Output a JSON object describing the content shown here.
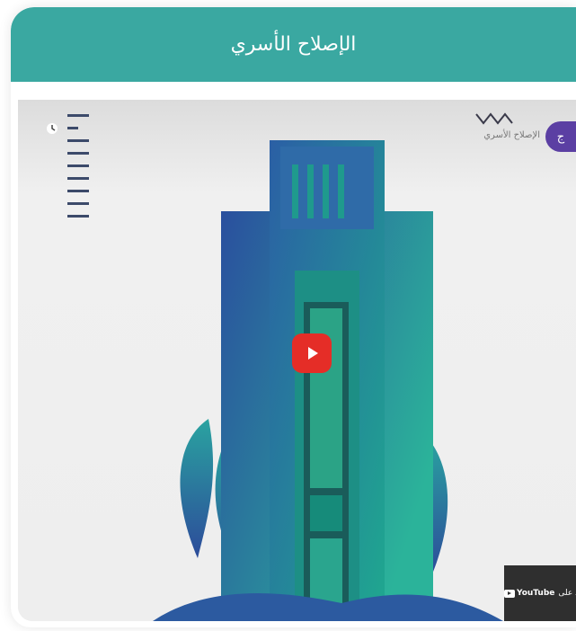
{
  "card": {
    "title": "الإصلاح الأسري"
  },
  "video": {
    "channel_name": "الإصلاح الأسري",
    "channel_avatar_letter": "ج",
    "play_icon": "play-icon",
    "youtube_badge": {
      "watch_text": "شاهد على",
      "logo_text": "YouTube"
    }
  },
  "colors": {
    "header": "#3aa8a1",
    "play_button": "#e52d27",
    "avatar": "#5b3fa3",
    "building_teal": "#2bb39a",
    "building_blue": "#2a4f9e"
  }
}
